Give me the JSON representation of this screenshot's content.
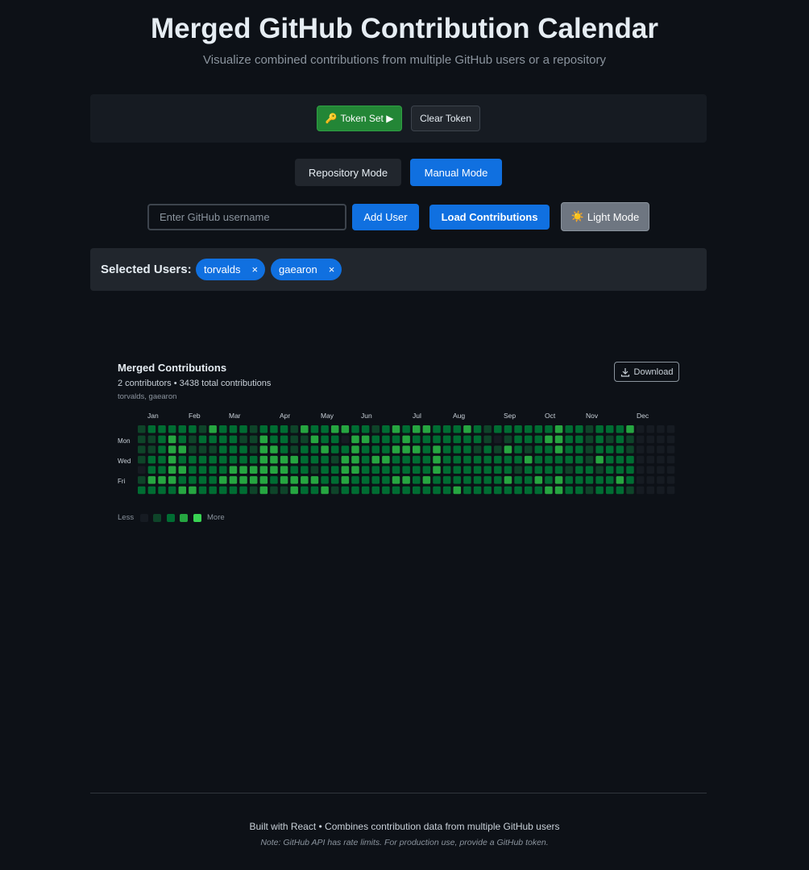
{
  "header": {
    "title": "Merged GitHub Contribution Calendar",
    "subtitle": "Visualize combined contributions from multiple GitHub users or a repository"
  },
  "token": {
    "set_label": "Token Set ▶",
    "key_icon": "key-icon",
    "clear_label": "Clear Token"
  },
  "modes": {
    "repository_label": "Repository Mode",
    "manual_label": "Manual Mode",
    "active": "manual"
  },
  "controls": {
    "username_placeholder": "Enter GitHub username",
    "username_value": "",
    "add_user_label": "Add User",
    "load_label": "Load Contributions",
    "theme_label": "Light Mode",
    "theme_icon": "sun-icon"
  },
  "selected_users": {
    "label": "Selected Users:",
    "users": [
      "torvalds",
      "gaearon"
    ],
    "remove_glyph": "×"
  },
  "calendar": {
    "title": "Merged Contributions",
    "stats": "2 contributors • 3438 total contributions",
    "users_line": "torvalds, gaearon",
    "download_label": "Download",
    "months": [
      "Jan",
      "Feb",
      "Mar",
      "Apr",
      "May",
      "Jun",
      "Jul",
      "Aug",
      "Sep",
      "Oct",
      "Nov",
      "Dec"
    ],
    "days": [
      "Mon",
      "Wed",
      "Fri"
    ],
    "legend_less": "Less",
    "legend_more": "More",
    "level_colors": [
      "#161b22",
      "#0e4429",
      "#006d32",
      "#26a641",
      "#39d353"
    ],
    "weeks": 53,
    "levels": [
      [
        1,
        1,
        1,
        1,
        0,
        1,
        2
      ],
      [
        2,
        1,
        1,
        2,
        2,
        3,
        2
      ],
      [
        2,
        2,
        2,
        2,
        2,
        3,
        2
      ],
      [
        2,
        3,
        3,
        3,
        3,
        3,
        2
      ],
      [
        2,
        2,
        3,
        2,
        3,
        2,
        3
      ],
      [
        2,
        1,
        1,
        2,
        2,
        2,
        3
      ],
      [
        1,
        2,
        1,
        2,
        2,
        2,
        2
      ],
      [
        3,
        2,
        1,
        2,
        2,
        2,
        2
      ],
      [
        2,
        2,
        2,
        2,
        2,
        3,
        2
      ],
      [
        2,
        2,
        2,
        2,
        3,
        3,
        2
      ],
      [
        2,
        1,
        2,
        2,
        3,
        3,
        2
      ],
      [
        1,
        1,
        1,
        2,
        3,
        3,
        1
      ],
      [
        2,
        3,
        3,
        3,
        3,
        3,
        3
      ],
      [
        2,
        2,
        3,
        3,
        3,
        2,
        1
      ],
      [
        2,
        2,
        2,
        3,
        3,
        3,
        1
      ],
      [
        1,
        1,
        1,
        3,
        2,
        3,
        3
      ],
      [
        3,
        1,
        2,
        2,
        2,
        3,
        2
      ],
      [
        2,
        3,
        2,
        2,
        1,
        3,
        2
      ],
      [
        2,
        2,
        3,
        2,
        2,
        2,
        3
      ],
      [
        3,
        2,
        2,
        1,
        2,
        2,
        1
      ],
      [
        3,
        0,
        2,
        3,
        3,
        3,
        2
      ],
      [
        2,
        3,
        3,
        3,
        3,
        2,
        2
      ],
      [
        2,
        3,
        2,
        2,
        2,
        2,
        2
      ],
      [
        1,
        2,
        2,
        3,
        2,
        2,
        2
      ],
      [
        2,
        2,
        2,
        3,
        2,
        2,
        2
      ],
      [
        3,
        2,
        3,
        2,
        2,
        3,
        2
      ],
      [
        2,
        3,
        3,
        2,
        2,
        3,
        2
      ],
      [
        3,
        2,
        3,
        2,
        2,
        2,
        2
      ],
      [
        3,
        2,
        2,
        2,
        2,
        3,
        2
      ],
      [
        2,
        2,
        3,
        3,
        3,
        2,
        2
      ],
      [
        2,
        2,
        2,
        2,
        2,
        2,
        2
      ],
      [
        2,
        2,
        2,
        2,
        2,
        2,
        3
      ],
      [
        3,
        2,
        2,
        2,
        2,
        2,
        2
      ],
      [
        2,
        2,
        1,
        2,
        2,
        2,
        2
      ],
      [
        1,
        1,
        2,
        2,
        2,
        2,
        2
      ],
      [
        2,
        0,
        1,
        2,
        2,
        2,
        2
      ],
      [
        2,
        1,
        3,
        2,
        2,
        3,
        2
      ],
      [
        2,
        2,
        2,
        2,
        1,
        2,
        2
      ],
      [
        2,
        2,
        1,
        3,
        2,
        2,
        2
      ],
      [
        2,
        2,
        2,
        2,
        2,
        3,
        2
      ],
      [
        2,
        3,
        2,
        2,
        2,
        2,
        3
      ],
      [
        3,
        3,
        3,
        2,
        2,
        3,
        3
      ],
      [
        2,
        2,
        2,
        2,
        1,
        2,
        2
      ],
      [
        2,
        2,
        2,
        2,
        2,
        2,
        2
      ],
      [
        1,
        1,
        1,
        1,
        2,
        2,
        1
      ],
      [
        2,
        2,
        2,
        3,
        1,
        2,
        2
      ],
      [
        2,
        1,
        2,
        2,
        2,
        2,
        2
      ],
      [
        2,
        2,
        2,
        2,
        2,
        3,
        2
      ],
      [
        3,
        1,
        1,
        2,
        2,
        2,
        1
      ],
      [
        0,
        0,
        0,
        0,
        0,
        0,
        0
      ],
      [
        0,
        0,
        0,
        0,
        0,
        0,
        0
      ],
      [
        0,
        0,
        0,
        0,
        0,
        0,
        0
      ],
      [
        0,
        0,
        0,
        0,
        0,
        0,
        0
      ]
    ]
  },
  "footer": {
    "main": "Built with React • Combines contribution data from multiple GitHub users",
    "note": "Note: GitHub API has rate limits. For production use, provide a GitHub token."
  }
}
